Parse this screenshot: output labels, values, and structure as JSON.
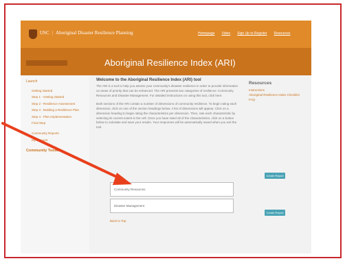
{
  "header": {
    "brand": "Aboriginal Disaster Resilience Planning",
    "logo_text": "USC",
    "nav": [
      "Homepage",
      "Video",
      "Sign Up to Register",
      "Resources"
    ]
  },
  "hero": {
    "title": "Aboriginal Resilience Index (ARI)"
  },
  "sidebar": {
    "heading": "Launch",
    "items": [
      "Getting Started",
      "Step 1 - Getting Started",
      "Step 2 - Resilience Assessment",
      "Step 3 - Building a Resilience Plan",
      "Step 4 - Plan Implementation",
      "Final Step",
      "Community Reports",
      "My Account"
    ],
    "cta": "Community Toolkit"
  },
  "main": {
    "welcome_title": "Welcome to the Aboriginal Resilience Index (ARI) tool",
    "para1": "The ARI is a tool to help you assess your community's disaster resilience in order to provide information on areas of priority that can be enhanced. The ARI presents two categories of resilience: Community Resources and Disaster Management. For detailed instructions on using this tool, click here.",
    "para2": "Both sections of the ARI contain a number of dimensions of community resilience. To begin rating each dimension, click on one of the section headings below. A list of dimensions will appear. Click on a dimension heading to begin rating the characteristics per dimension. Then, rate each characteristic by selecting its current extent in the cell. Once you have rated all of the characteristics, click on a button below to calculate and save your results. Your responses will be automatically saved when you exit the tool.",
    "start_label": "Create Report",
    "sections": [
      "Community Resources",
      "Disaster Management"
    ],
    "back_link": "Back to Top"
  },
  "resources": {
    "title": "Resources",
    "links": [
      "Instructions",
      "Aboriginal Resilience Index Checklist",
      "FAQ"
    ]
  },
  "colors": {
    "accent": "#e08a2a",
    "frame": "#c8262a",
    "button": "#4aa3b5"
  }
}
